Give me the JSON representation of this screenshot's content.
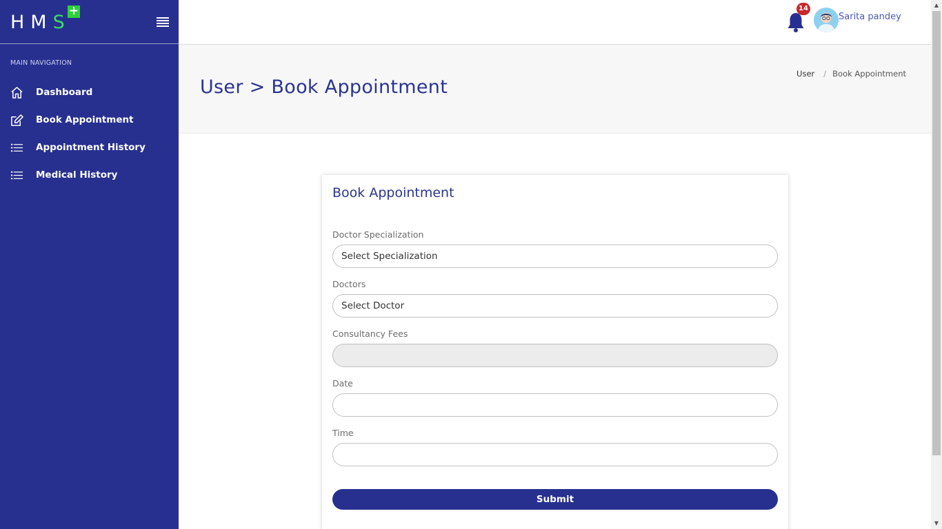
{
  "brand": {
    "logo_letters": "HM",
    "logo_last": "S",
    "logo_plus": "+"
  },
  "sidebar": {
    "heading": "MAIN NAVIGATION",
    "items": [
      {
        "label": "Dashboard",
        "icon": "home-icon"
      },
      {
        "label": "Book Appointment",
        "icon": "edit-icon"
      },
      {
        "label": "Appointment History",
        "icon": "list-icon"
      },
      {
        "label": "Medical History",
        "icon": "list-icon"
      }
    ]
  },
  "topbar": {
    "notification_count": "14",
    "username": "Sarita pandey"
  },
  "page": {
    "title": "User > Book Appointment",
    "breadcrumb": [
      "User",
      "Book Appointment"
    ]
  },
  "form": {
    "title": "Book Appointment",
    "fields": [
      {
        "label": "Doctor Specialization",
        "value": "Select Specialization"
      },
      {
        "label": "Doctors",
        "value": "Select Doctor"
      },
      {
        "label": "Consultancy Fees",
        "value": ""
      },
      {
        "label": "Date",
        "value": ""
      },
      {
        "label": "Time",
        "value": ""
      }
    ],
    "submit_label": "Submit"
  },
  "colors": {
    "sidebar_bg": "#27308f",
    "accent_green": "#2fd13b",
    "badge_red": "#c6282b",
    "title_blue": "#2a3490"
  }
}
